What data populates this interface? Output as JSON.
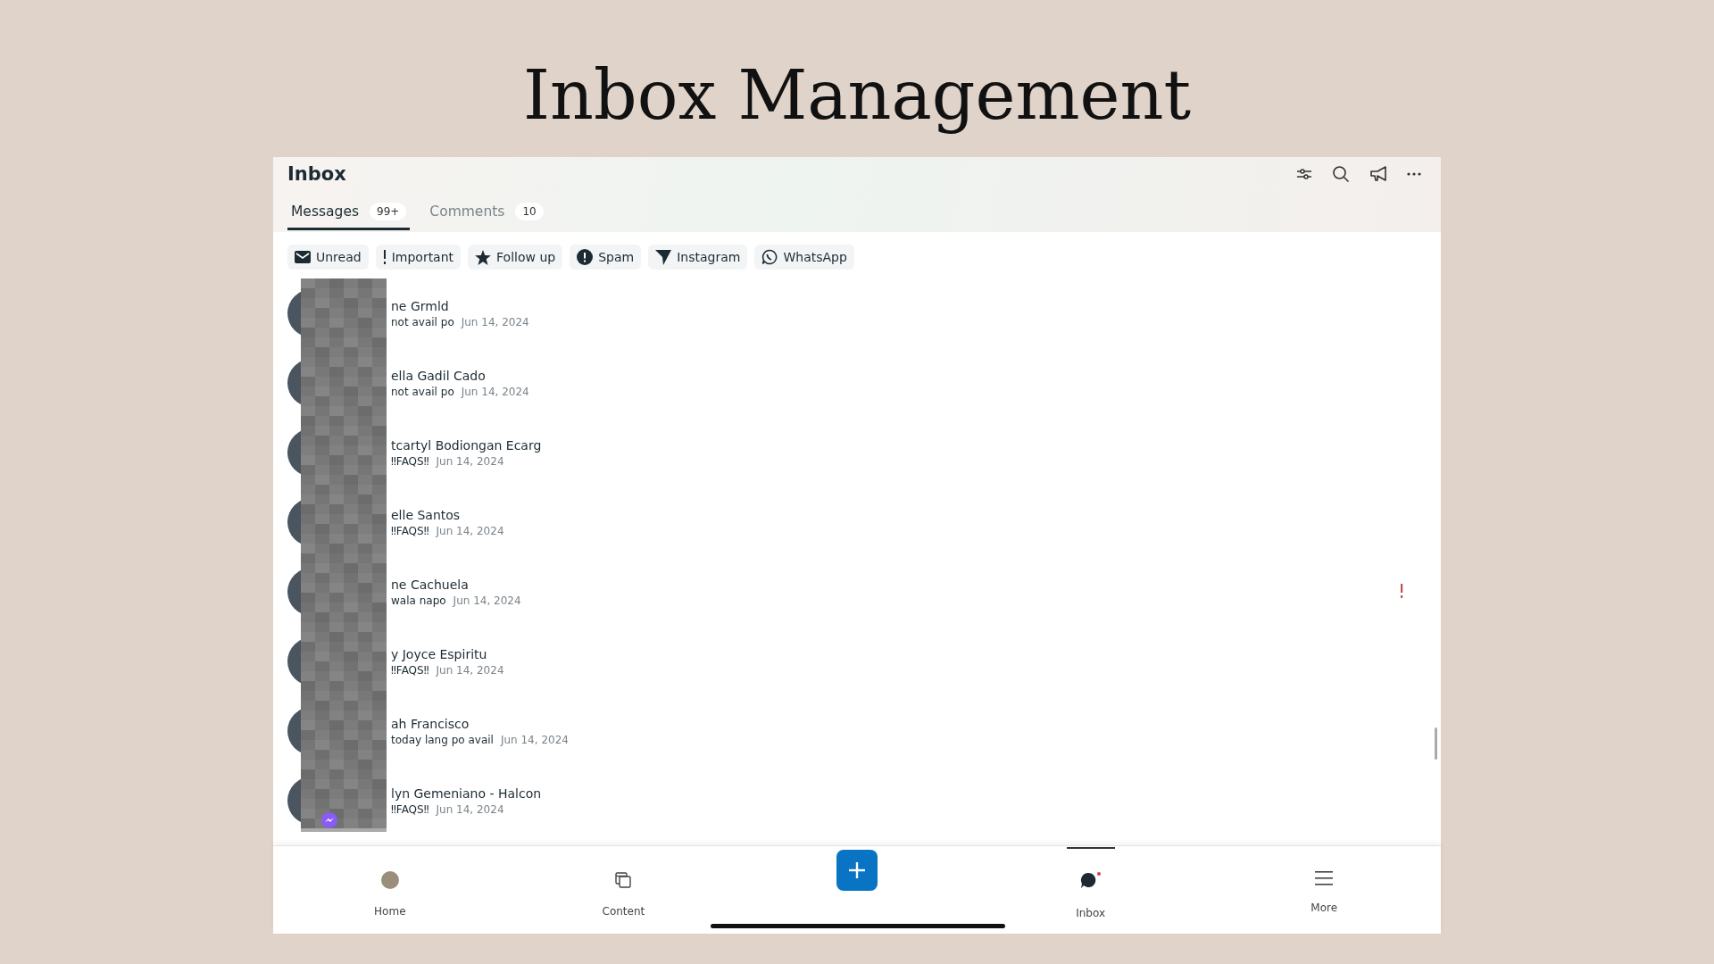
{
  "page_title": "Inbox Management",
  "header": {
    "title": "Inbox"
  },
  "tabs": [
    {
      "label": "Messages",
      "count": "99+",
      "selected": true
    },
    {
      "label": "Comments",
      "count": "10",
      "selected": false
    }
  ],
  "filters": [
    {
      "label": "Unread",
      "kind": "envelope"
    },
    {
      "label": "Important",
      "kind": "exclamation"
    },
    {
      "label": "Follow up",
      "kind": "star"
    },
    {
      "label": "Spam",
      "kind": "alert"
    },
    {
      "label": "Instagram",
      "kind": "send"
    },
    {
      "label": "WhatsApp",
      "kind": "whatsapp"
    }
  ],
  "conversations": [
    {
      "name": "ne Grmld",
      "preview": "not avail po",
      "date": "Jun 14, 2024",
      "important": false,
      "messenger_badge": false
    },
    {
      "name": "ella Gadil Cado",
      "preview": "not avail po",
      "date": "Jun 14, 2024",
      "important": false,
      "messenger_badge": false
    },
    {
      "name": "tcartyl Bodiongan Ecarg",
      "preview": "‼FAQS‼",
      "date": "Jun 14, 2024",
      "important": false,
      "messenger_badge": false
    },
    {
      "name": "elle Santos",
      "preview": "‼FAQS‼",
      "date": "Jun 14, 2024",
      "important": false,
      "messenger_badge": false
    },
    {
      "name": "ne Cachuela",
      "preview": "wala napo",
      "date": "Jun 14, 2024",
      "important": true,
      "messenger_badge": false
    },
    {
      "name": "y Joyce Espiritu",
      "preview": "‼FAQS‼",
      "date": "Jun 14, 2024",
      "important": false,
      "messenger_badge": false
    },
    {
      "name": "ah Francisco",
      "preview": "today lang po avail",
      "date": "Jun 14, 2024",
      "important": false,
      "messenger_badge": false
    },
    {
      "name": "lyn Gemeniano - Halcon",
      "preview": "‼FAQS‼",
      "date": "Jun 14, 2024",
      "important": false,
      "messenger_badge": true
    }
  ],
  "bottom_nav": [
    {
      "label": "Home",
      "kind": "avatar",
      "selected": false
    },
    {
      "label": "Content",
      "kind": "content",
      "selected": false
    },
    {
      "kind": "create",
      "selected": false
    },
    {
      "label": "Inbox",
      "kind": "chat",
      "selected": true
    },
    {
      "label": "More",
      "kind": "menu",
      "selected": false
    }
  ]
}
